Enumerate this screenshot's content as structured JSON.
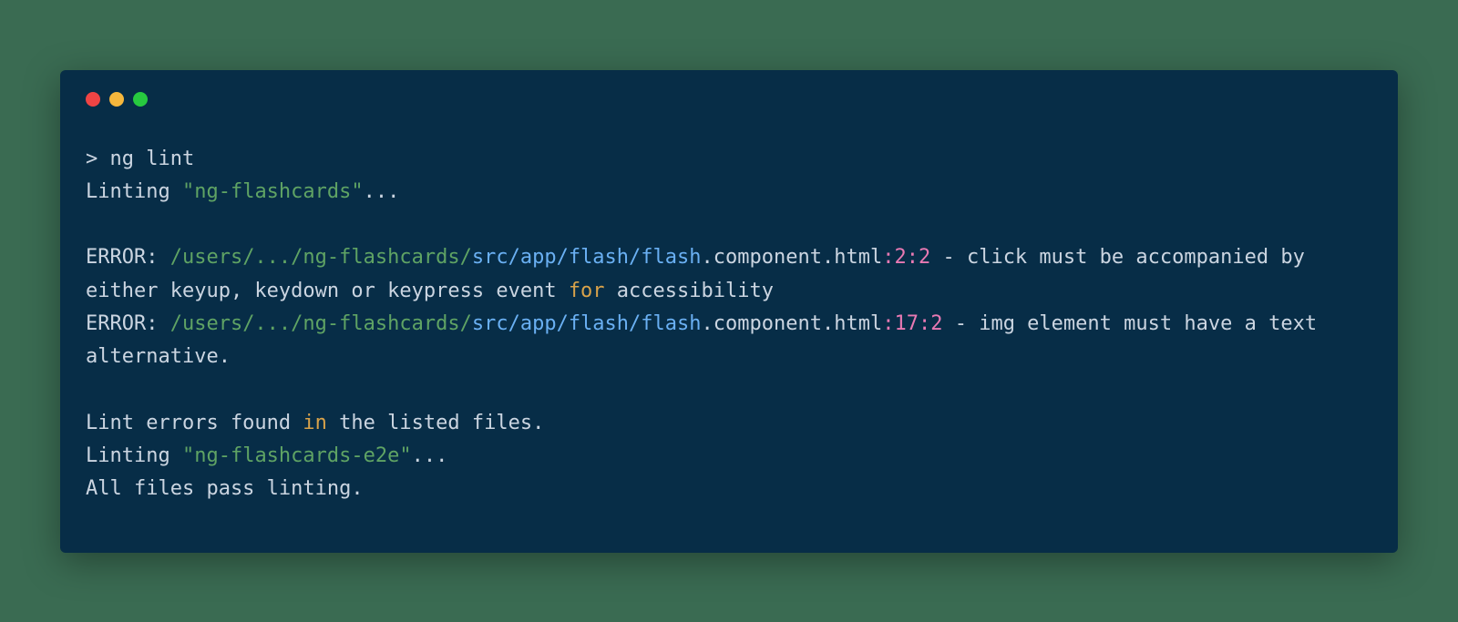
{
  "prompt": "> ng lint",
  "linting1_prefix": "Linting ",
  "linting1_name": "\"ng-flashcards\"",
  "linting1_suffix": "...",
  "error1": {
    "label": "ERROR: ",
    "path_a": "/users/.../ng-flashcards/",
    "path_b": "src/app/flash/flash",
    "path_c": ".component.html",
    "loc": ":2:2",
    "sep": " - ",
    "msg_a": "click must be accompanied by either keyup, keydown or keypress event ",
    "for": "for",
    "msg_b": " accessibility"
  },
  "error2": {
    "label": "ERROR: ",
    "path_a": "/users/.../ng-flashcards/",
    "path_b": "src/app/flash/flash",
    "path_c": ".component.html",
    "loc": ":17:2",
    "sep": " - ",
    "msg": "img element must have a text alternative."
  },
  "summary_a": "Lint errors found ",
  "summary_in": "in",
  "summary_b": " the listed files.",
  "linting2_prefix": "Linting ",
  "linting2_name": "\"ng-flashcards-e2e\"",
  "linting2_suffix": "...",
  "pass": "All files pass linting."
}
